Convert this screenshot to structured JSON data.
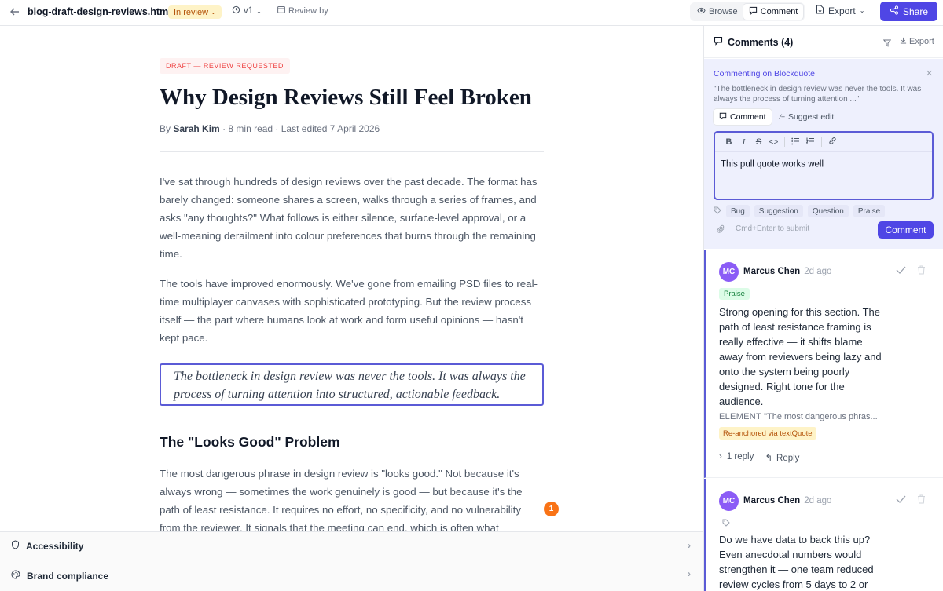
{
  "header": {
    "filename": "blog-draft-design-reviews.html",
    "status": "In review",
    "version": "v1",
    "review_by": "Review by",
    "mode_browse": "Browse",
    "mode_comment": "Comment",
    "export": "Export",
    "share": "Share"
  },
  "doc": {
    "badge": "DRAFT — REVIEW REQUESTED",
    "title": "Why Design Reviews Still Feel Broken",
    "byline_prefix": "By",
    "author": "Sarah Kim",
    "meta": "· 8 min read · Last edited 7 April 2026",
    "p1": "I've sat through hundreds of design reviews over the past decade. The format has barely changed: someone shares a screen, walks through a series of frames, and asks \"any thoughts?\" What follows is either silence, surface-level approval, or a well-meaning derailment into colour preferences that burns through the remaining time.",
    "p2": "The tools have improved enormously. We've gone from emailing PSD files to real-time multiplayer canvases with sophisticated prototyping. But the review process itself — the part where humans look at work and form useful opinions — hasn't kept pace.",
    "quote": "The bottleneck in design review was never the tools. It was always the process of turning attention into structured, actionable feedback.",
    "h2": "The \"Looks Good\" Problem",
    "p3": "The most dangerous phrase in design review is \"looks good.\" Not because it's always wrong — sometimes the work genuinely is good — but because it's the path of least resistance. It requires no effort, no specificity, and no vulnerability from the reviewer. It signals that the meeting can end, which is often what",
    "pin_count": "1"
  },
  "panels": {
    "accessibility": "Accessibility",
    "brand": "Brand compliance"
  },
  "sidebar": {
    "title": "Comments (4)",
    "export": "Export",
    "composer": {
      "target": "Commenting on Blockquote",
      "excerpt": "\"The bottleneck in design review was never the tools. It was always the process of turning attention ...\"",
      "tab_comment": "Comment",
      "tab_suggest": "Suggest edit",
      "text": "This pull quote works well",
      "tags": [
        "Bug",
        "Suggestion",
        "Question",
        "Praise"
      ],
      "hint": "Cmd+Enter to submit",
      "submit": "Comment"
    },
    "comments": [
      {
        "initials": "MC",
        "author": "Marcus Chen",
        "time": "2d ago",
        "tag": "Praise",
        "body": "Strong opening for this section. The path of least resistance framing is really effective — it shifts blame away from reviewers being lazy and onto the system being poorly designed. Right tone for the audience.",
        "element_label": "ELEMENT",
        "element_quote": "\"The most dangerous phras...",
        "reanchored": "Re-anchored via textQuote",
        "replies": "1 reply",
        "reply": "Reply"
      },
      {
        "initials": "MC",
        "author": "Marcus Chen",
        "time": "2d ago",
        "body": "Do we have data to back this up? Even anecdotal numbers would strengthen it — one team reduced review cycles from 5 days to 2 or"
      }
    ]
  },
  "colors": {
    "accent": "#4f46e5",
    "status_bg": "#fef3c7",
    "pin": "#f97316",
    "avatar": "#8b5cf6"
  }
}
